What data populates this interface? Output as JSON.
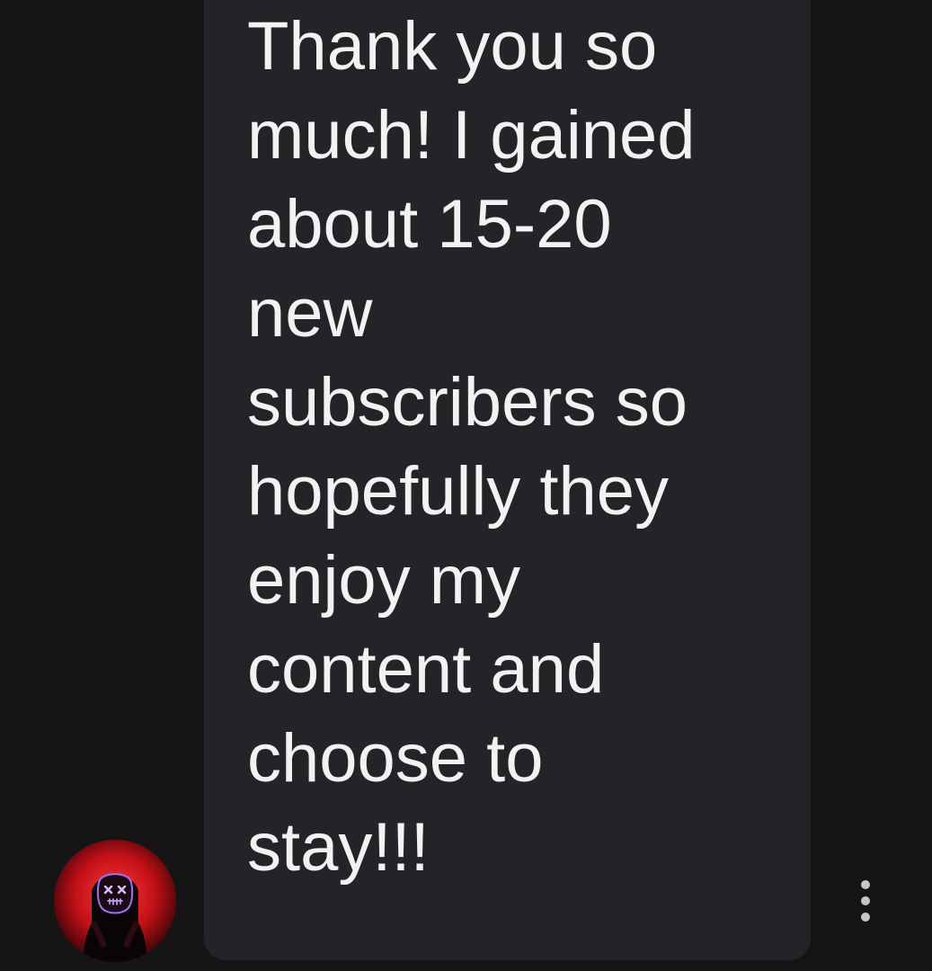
{
  "message": {
    "text": "Thank you so\nmuch! I gained\nabout 15-20\nnew\nsubscribers so\nhopefully they\nenjoy my\ncontent and\nchoose to\nstay!!!"
  },
  "colors": {
    "background": "#151515",
    "bubble": "#232328",
    "text": "#f2f2f2",
    "avatar_red": "#ff2a2a",
    "mask_glow": "#b78cff",
    "options_dots": "#c7c7c7"
  },
  "icons": {
    "avatar": "masked-user-avatar",
    "more_options": "vertical-ellipsis-icon"
  }
}
